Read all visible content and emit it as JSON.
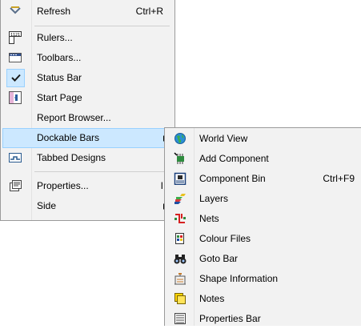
{
  "main_menu": {
    "refresh": {
      "label": "Refresh",
      "shortcut": "Ctrl+R",
      "icon": "refresh-icon"
    },
    "rulers": {
      "label": "Rulers...",
      "icon": "rulers-icon"
    },
    "toolbars": {
      "label": "Toolbars...",
      "icon": "toolbars-icon"
    },
    "status_bar": {
      "label": "Status Bar",
      "checked": true,
      "icon": "checkmark-icon"
    },
    "start_page": {
      "label": "Start Page",
      "icon": "start-page-icon"
    },
    "report_browser": {
      "label": "Report Browser..."
    },
    "dockable_bars": {
      "label": "Dockable Bars",
      "highlighted": true,
      "has_submenu": true
    },
    "tabbed_designs": {
      "label": "Tabbed Designs",
      "icon": "tabbed-designs-icon"
    },
    "properties": {
      "label": "Properties...",
      "shortcut": "I",
      "icon": "properties-icon"
    },
    "side": {
      "label": "Side",
      "has_submenu": true
    }
  },
  "submenu": {
    "items": [
      {
        "label": "World View",
        "icon": "globe-icon"
      },
      {
        "label": "Add Component",
        "icon": "add-component-icon"
      },
      {
        "label": "Component Bin",
        "shortcut": "Ctrl+F9",
        "icon": "component-bin-icon"
      },
      {
        "label": "Layers",
        "icon": "layers-icon"
      },
      {
        "label": "Nets",
        "icon": "nets-icon"
      },
      {
        "label": "Colour Files",
        "icon": "colour-files-icon"
      },
      {
        "label": "Goto Bar",
        "icon": "binoculars-icon"
      },
      {
        "label": "Shape Information",
        "icon": "shape-information-icon"
      },
      {
        "label": "Notes",
        "icon": "notes-icon"
      },
      {
        "label": "Properties Bar",
        "icon": "properties-bar-icon"
      }
    ]
  },
  "colors": {
    "menu_bg": "#f2f2f2",
    "highlight_bg": "#cce8ff",
    "highlight_border": "#99d1ff",
    "menu_border": "#9a9a9a"
  }
}
